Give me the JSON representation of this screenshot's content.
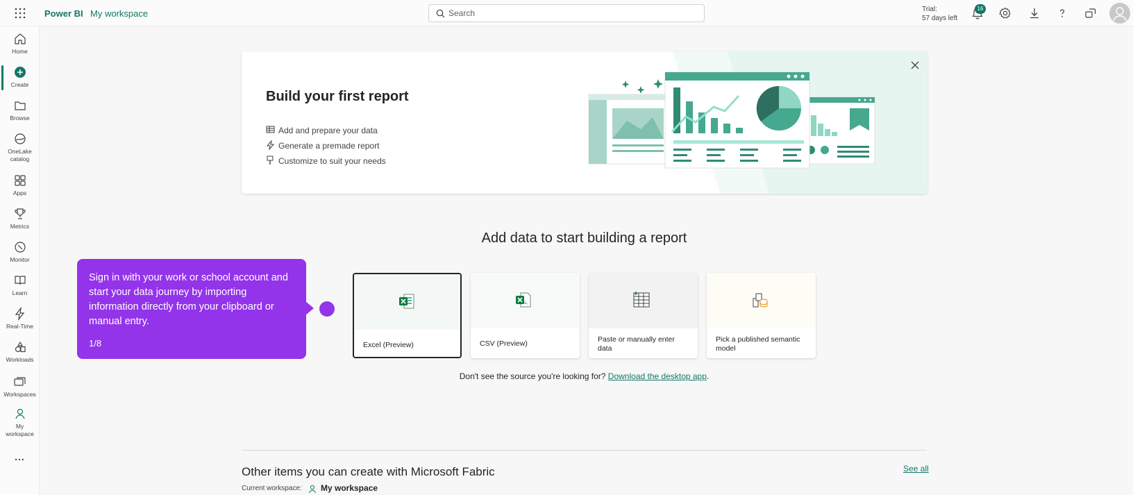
{
  "topbar": {
    "brand": "Power BI",
    "workspace_crumb": "My workspace",
    "search_placeholder": "Search",
    "trial_line1": "Trial:",
    "trial_line2": "57 days left",
    "notification_count": "16"
  },
  "nav": {
    "items": [
      {
        "label": "Home",
        "icon": "home-icon"
      },
      {
        "label": "Create",
        "icon": "create-icon"
      },
      {
        "label": "Browse",
        "icon": "folder-icon"
      },
      {
        "label": "OneLake",
        "label2": "catalog",
        "icon": "onelake-icon"
      },
      {
        "label": "Apps",
        "icon": "apps-icon"
      },
      {
        "label": "Metrics",
        "icon": "trophy-icon"
      },
      {
        "label": "Monitor",
        "icon": "monitor-icon"
      },
      {
        "label": "Learn",
        "icon": "book-icon"
      },
      {
        "label": "Real-Time",
        "icon": "lightning-icon"
      },
      {
        "label": "Workloads",
        "icon": "workloads-icon"
      },
      {
        "label": "Workspaces",
        "icon": "workspaces-icon"
      },
      {
        "label": "My",
        "label2": "workspace",
        "icon": "person-icon"
      }
    ],
    "more": "..."
  },
  "banner": {
    "title": "Build your first report",
    "bullets": [
      {
        "text": "Add and prepare your data",
        "icon": "table-icon"
      },
      {
        "text": "Generate a premade report",
        "icon": "lightning-icon"
      },
      {
        "text": "Customize to suit your needs",
        "icon": "brush-icon"
      }
    ]
  },
  "add_data": {
    "title": "Add data to start building a report",
    "cards": [
      {
        "label": "Excel (Preview)",
        "icon": "excel-icon",
        "selected": true
      },
      {
        "label": "CSV (Preview)",
        "icon": "csv-icon",
        "selected": false
      },
      {
        "label": "Paste or manually enter",
        "label2": "data",
        "icon": "table-grid-icon",
        "selected": false
      },
      {
        "label": "Pick a published semantic",
        "label2": "model",
        "icon": "semantic-model-icon",
        "selected": false
      }
    ],
    "hint_prefix": "Don't see the source you're looking for?",
    "hint_link": "Download the desktop app",
    "hint_suffix": "."
  },
  "other": {
    "title": "Other items you can create with Microsoft Fabric",
    "see_all": "See all",
    "current_workspace_label": "Current workspace:",
    "current_workspace_value": "My workspace"
  },
  "tooltip": {
    "text": "Sign in with your work or school account and start your data journey by importing information directly from your clipboard or manual entry.",
    "step": "1/8"
  },
  "colors": {
    "accent": "#117865",
    "tooltip": "#9333ea"
  }
}
